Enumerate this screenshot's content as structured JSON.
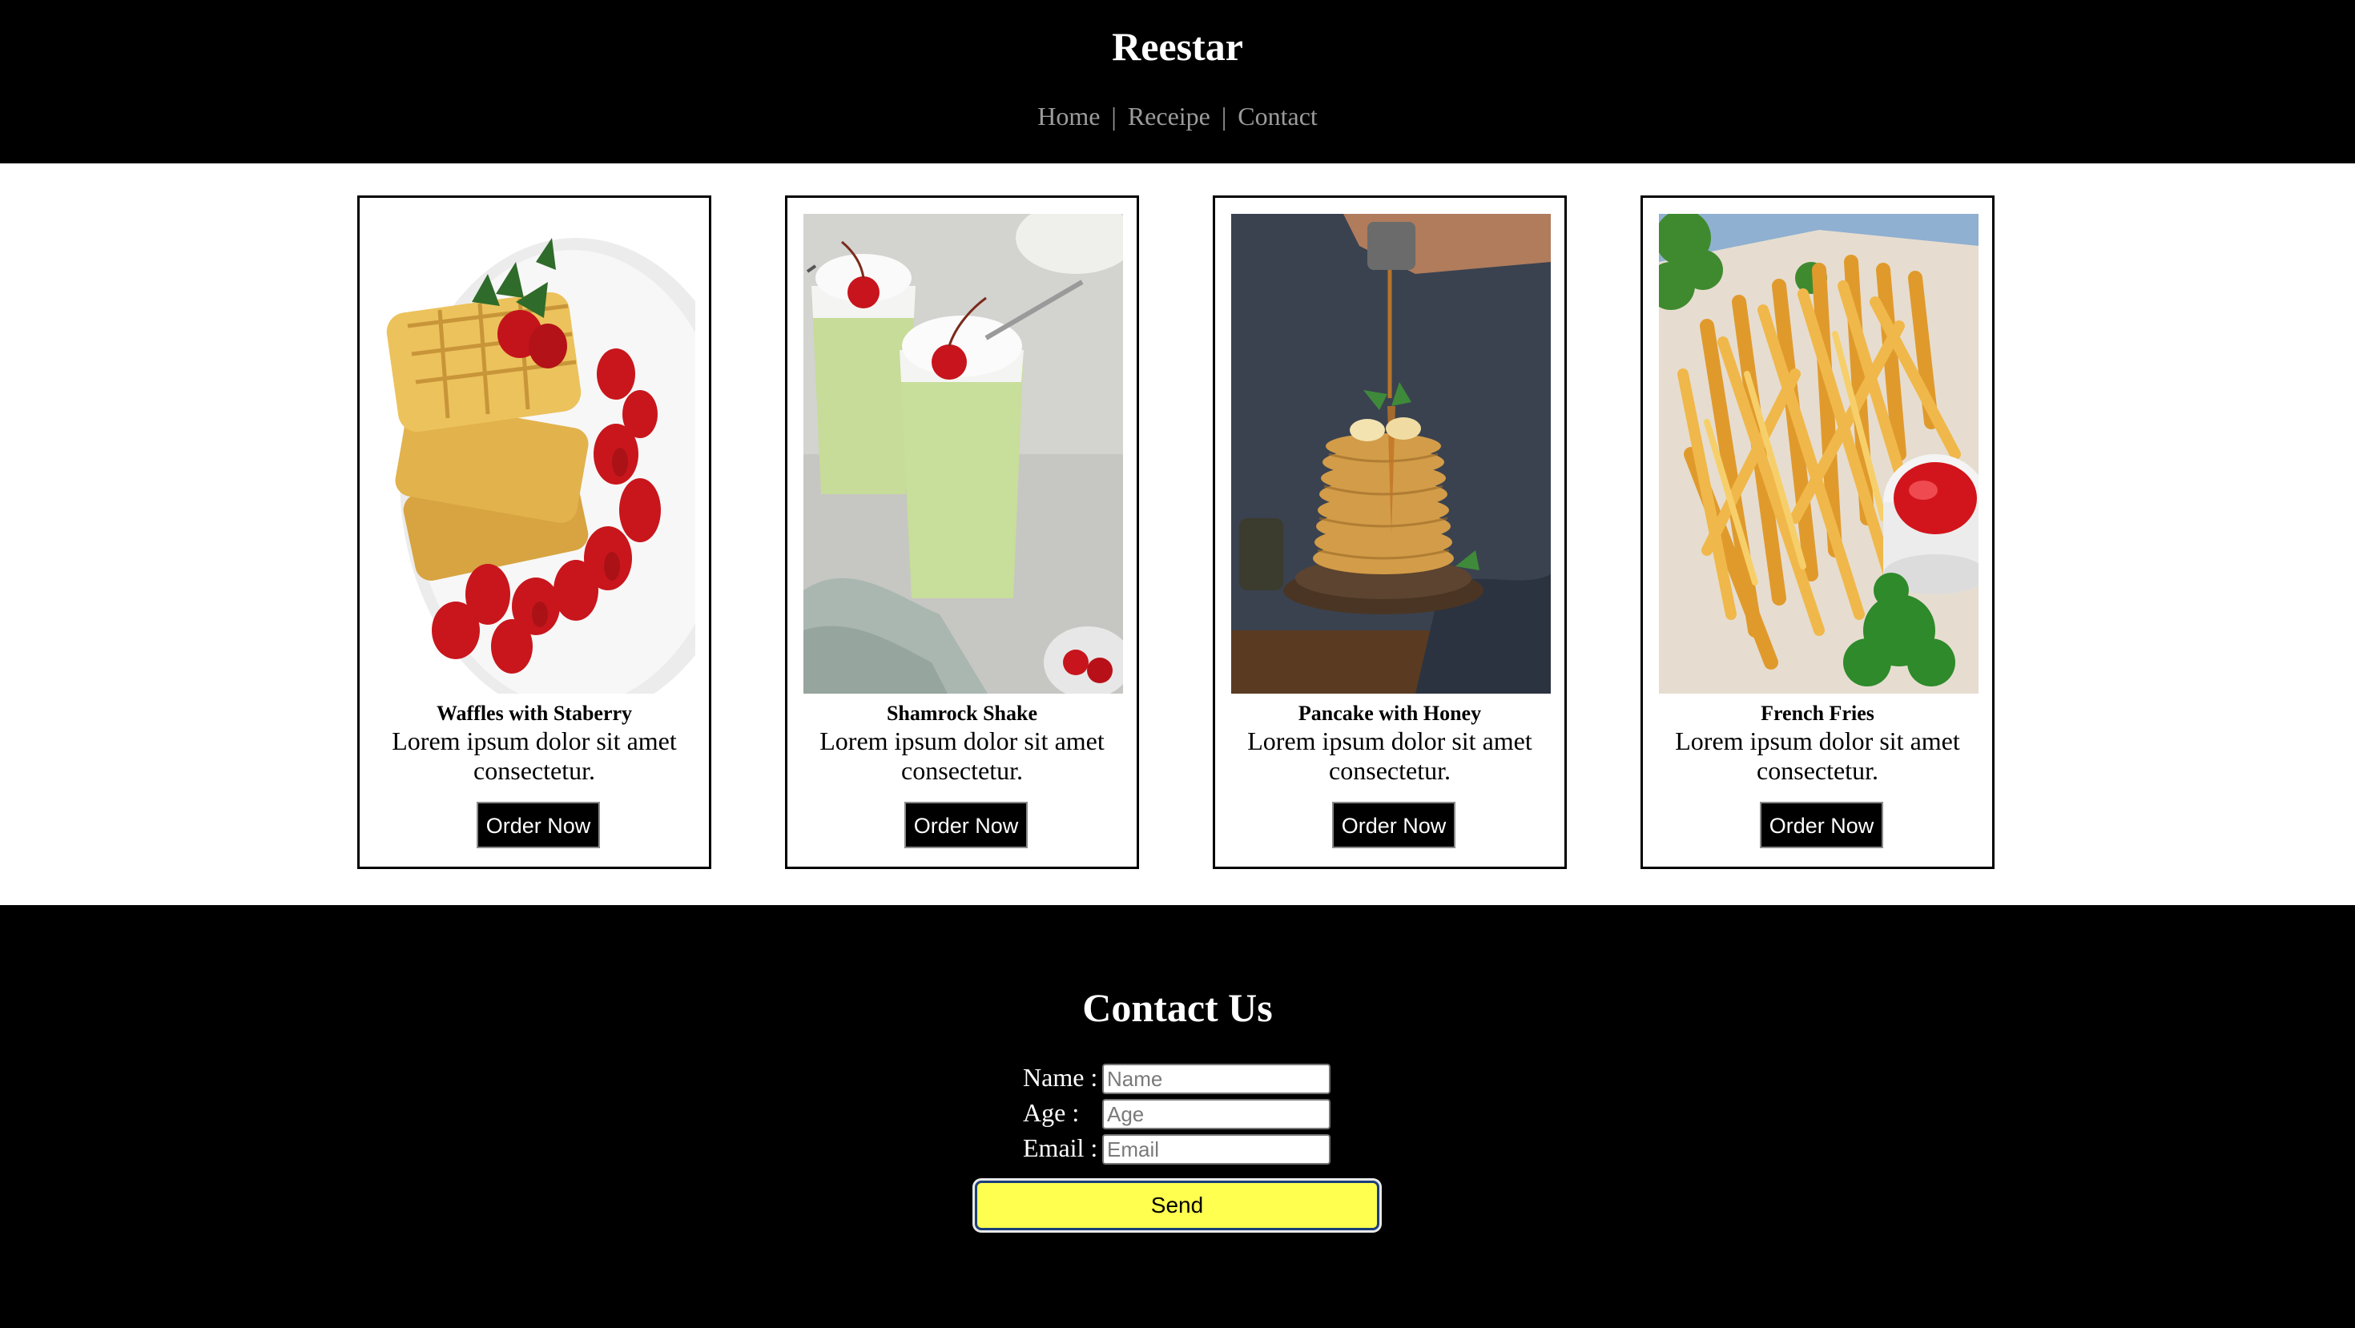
{
  "header": {
    "brand": "Reestar",
    "nav": [
      {
        "label": "Home"
      },
      {
        "label": "Receipe"
      },
      {
        "label": "Contact"
      }
    ],
    "separator": "|"
  },
  "cards": [
    {
      "title": "Waffles with Staberry",
      "description": "Lorem ipsum dolor sit amet consectetur.",
      "button": "Order Now"
    },
    {
      "title": "Shamrock Shake",
      "description": "Lorem ipsum dolor sit amet consectetur.",
      "button": "Order Now"
    },
    {
      "title": "Pancake with Honey",
      "description": "Lorem ipsum dolor sit amet consectetur.",
      "button": "Order Now"
    },
    {
      "title": "French Fries",
      "description": "Lorem ipsum dolor sit amet consectetur.",
      "button": "Order Now"
    }
  ],
  "contact": {
    "title": "Contact Us",
    "fields": [
      {
        "label": "Name :",
        "placeholder": "Name"
      },
      {
        "label": "Age :",
        "placeholder": "Age"
      },
      {
        "label": "Email :",
        "placeholder": "Email"
      }
    ],
    "send_label": "Send"
  },
  "colors": {
    "header_bg": "#000000",
    "nav_text": "#9c9c9c",
    "send_bg": "#ffff4f",
    "button_bg": "#000000"
  }
}
